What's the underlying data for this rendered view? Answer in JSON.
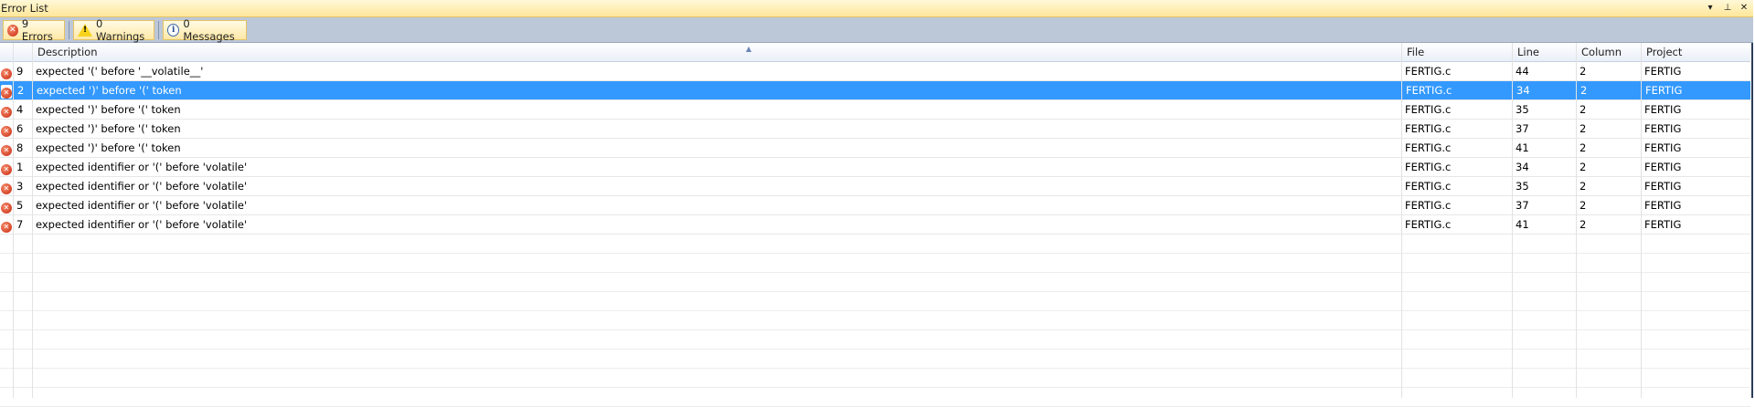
{
  "window": {
    "title": "Error List",
    "controls": {
      "dropdown": "▾",
      "pin": "⊥",
      "close": "✕"
    }
  },
  "toolbar": {
    "errors": "9 Errors",
    "warnings": "0 Warnings",
    "messages": "0 Messages"
  },
  "columns": {
    "description": "Description",
    "file": "File",
    "line": "Line",
    "column": "Column",
    "project": "Project"
  },
  "rows": [
    {
      "num": "9",
      "description": "expected '(' before '__volatile__'",
      "file": "FERTIG.c",
      "line": "44",
      "column": "2",
      "project": "FERTIG",
      "selected": false
    },
    {
      "num": "2",
      "description": "expected ')' before '(' token",
      "file": "FERTIG.c",
      "line": "34",
      "column": "2",
      "project": "FERTIG",
      "selected": true
    },
    {
      "num": "4",
      "description": "expected ')' before '(' token",
      "file": "FERTIG.c",
      "line": "35",
      "column": "2",
      "project": "FERTIG",
      "selected": false
    },
    {
      "num": "6",
      "description": "expected ')' before '(' token",
      "file": "FERTIG.c",
      "line": "37",
      "column": "2",
      "project": "FERTIG",
      "selected": false
    },
    {
      "num": "8",
      "description": "expected ')' before '(' token",
      "file": "FERTIG.c",
      "line": "41",
      "column": "2",
      "project": "FERTIG",
      "selected": false
    },
    {
      "num": "1",
      "description": "expected identifier or '(' before 'volatile'",
      "file": "FERTIG.c",
      "line": "34",
      "column": "2",
      "project": "FERTIG",
      "selected": false
    },
    {
      "num": "3",
      "description": "expected identifier or '(' before 'volatile'",
      "file": "FERTIG.c",
      "line": "35",
      "column": "2",
      "project": "FERTIG",
      "selected": false
    },
    {
      "num": "5",
      "description": "expected identifier or '(' before 'volatile'",
      "file": "FERTIG.c",
      "line": "37",
      "column": "2",
      "project": "FERTIG",
      "selected": false
    },
    {
      "num": "7",
      "description": "expected identifier or '(' before 'volatile'",
      "file": "FERTIG.c",
      "line": "41",
      "column": "2",
      "project": "FERTIG",
      "selected": false
    }
  ],
  "colors": {
    "selection": "#3399ff",
    "titlebar": "#ffe79a",
    "toolbar": "#bcc7d8",
    "error_icon": "#c92a10"
  },
  "icons": {
    "error": "error-icon",
    "warning": "warning-icon",
    "info": "info-icon"
  }
}
